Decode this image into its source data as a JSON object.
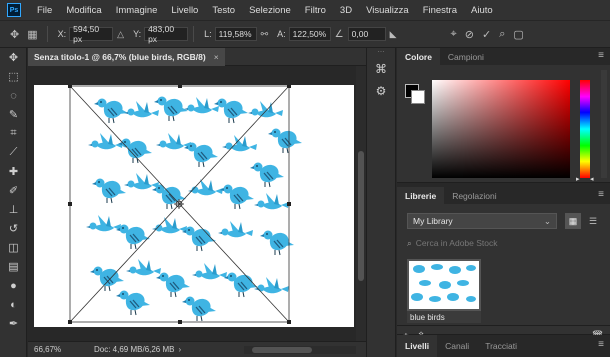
{
  "app": {
    "logo": "Ps"
  },
  "menu": [
    "File",
    "Modifica",
    "Immagine",
    "Livello",
    "Testo",
    "Selezione",
    "Filtro",
    "3D",
    "Visualizza",
    "Finestra",
    "Aiuto"
  ],
  "options": {
    "x_label": "X:",
    "x_value": "594,50 px",
    "y_label": "Y:",
    "y_value": "483,00 px",
    "w_label": "L:",
    "w_value": "119,58%",
    "h_label": "A:",
    "h_value": "122,50%",
    "angle_value": "0,00"
  },
  "document": {
    "tab_title": "Senza titolo-1 @ 66,7% (blue birds, RGB/8)",
    "zoom": "66,67%",
    "doc_info": "Doc: 4,69 MB/6,26 MB"
  },
  "color_panel": {
    "tabs": [
      "Colore",
      "Campioni"
    ],
    "accent_hue": "#ff0000"
  },
  "libraries_panel": {
    "tabs": [
      "Librerie",
      "Regolazioni"
    ],
    "library_name": "My Library",
    "search_placeholder": "Cerca in Adobe Stock",
    "item_name": "blue birds"
  },
  "layers_panel": {
    "tabs": [
      "Livelli",
      "Canali",
      "Tracciati"
    ]
  },
  "colors": {
    "bird": "#3fb4e3",
    "bird_dark": "#1f7fb2",
    "handles": "#222222"
  }
}
